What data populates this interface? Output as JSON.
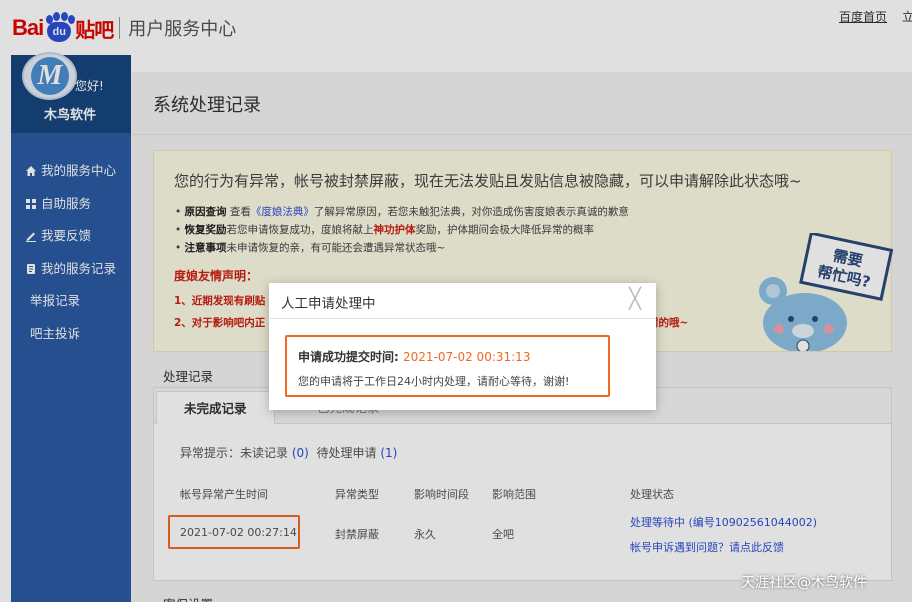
{
  "header": {
    "logo_bai": "Bai",
    "logo_du": "du",
    "logo_tieba": "贴吧",
    "title": "用户服务中心",
    "home_link": "百度首页",
    "edge_char": "立"
  },
  "sidebar": {
    "avatar_letter": "M",
    "greeting": "您好!",
    "username": "木鸟软件",
    "items": [
      {
        "label": "我的服务中心",
        "icon": "home-icon"
      },
      {
        "label": "自助服务",
        "icon": "grid-icon"
      },
      {
        "label": "我要反馈",
        "icon": "edit-icon"
      },
      {
        "label": "我的服务记录",
        "icon": "record-icon"
      },
      {
        "label": "举报记录"
      },
      {
        "label": "吧主投诉"
      }
    ]
  },
  "main": {
    "page_title": "系统处理记录",
    "notice": {
      "headline": "您的行为有异常，帐号被封禁屏蔽，现在无法发贴且发贴信息被隐藏，可以申请解除此状态哦~",
      "items": [
        {
          "label": "原因查询",
          "pre": " 查看",
          "link": "《度娘法典》",
          "post": "了解异常原因，若您未触犯法典，对你造成伤害度娘表示真诚的歉意"
        },
        {
          "label": "恢复奖励",
          "pre": "若您申请恢复成功，度娘将献上",
          "highlight": "神功护体",
          "post": "奖励，护体期间会极大降低异常的概率"
        },
        {
          "label": "注意事项",
          "pre": "未申请恢复的亲，有可能还会遭遇异常状态哦~"
        }
      ],
      "declaration_title": "度娘友情声明：",
      "declaration_1": "1、近期发现有刷贴",
      "declaration_2": "2、对于影响吧内正",
      "declaration_2_tail": "罚的哦~",
      "mascot_sign": "需要 帮忙吗?"
    },
    "records_label": "处理记录",
    "tabs": [
      "未完成记录",
      "已完成记录"
    ],
    "hint": {
      "prefix": "异常提示：",
      "unread_label": "未读记录",
      "unread_count": "(0)",
      "pending_label": "待处理申请",
      "pending_count": "(1)"
    },
    "table": {
      "headers": [
        "帐号异常产生时间",
        "异常类型",
        "影响时间段",
        "影响范围",
        "处理状态"
      ],
      "row": {
        "time": "2021-07-02 00:27:14",
        "type": "封禁屏蔽",
        "duration": "永久",
        "scope": "全吧",
        "status": "处理等待中 (编号10902561044002)",
        "appeal_link": "帐号申诉遇到问题？请点此反馈"
      }
    },
    "next_label": "密保设置"
  },
  "dialog": {
    "title": "人工申请处理中",
    "close_glyph": "╳",
    "submit_label": "申请成功提交时间:",
    "submit_time": "2021-07-02 00:31:13",
    "message": "您的申请将于工作日24小时内处理，请耐心等待，谢谢!"
  },
  "watermark": "天涯社区@木鸟软件",
  "colors": {
    "brand_red": "#e10601",
    "sidebar": "#2b5ba3",
    "highlight_orange": "#ef6a26",
    "link_blue": "#2d4fd6"
  }
}
